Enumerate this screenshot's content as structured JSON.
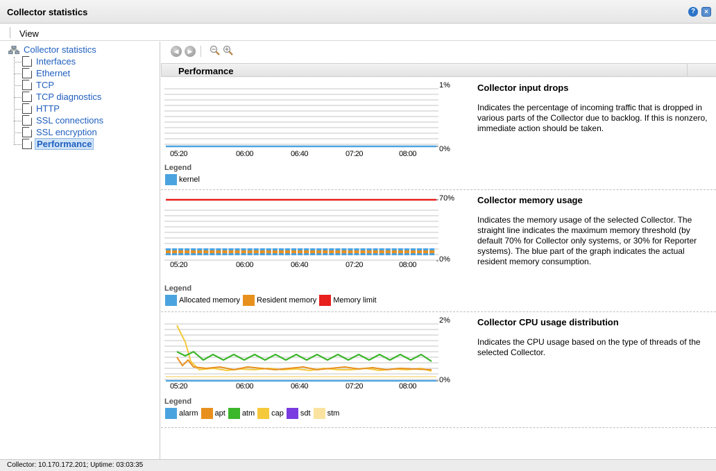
{
  "window": {
    "title": "Collector statistics",
    "help_glyph": "?",
    "close_glyph": "×"
  },
  "menu": {
    "view_label": "View"
  },
  "tree": {
    "root_label": "Collector statistics",
    "items": [
      {
        "label": "Interfaces",
        "selected": false
      },
      {
        "label": "Ethernet",
        "selected": false
      },
      {
        "label": "TCP",
        "selected": false
      },
      {
        "label": "TCP diagnostics",
        "selected": false
      },
      {
        "label": "HTTP",
        "selected": false
      },
      {
        "label": "SSL connections",
        "selected": false
      },
      {
        "label": "SSL encryption",
        "selected": false
      },
      {
        "label": "Performance",
        "selected": true
      }
    ]
  },
  "toolbar": {
    "back_icon": "back-arrow-icon",
    "forward_icon": "forward-arrow-icon",
    "zoom_out_icon": "zoom-out-icon",
    "zoom_in_icon": "zoom-in-icon"
  },
  "section": {
    "title": "Performance"
  },
  "panels": [
    {
      "title": "Collector input drops",
      "description": "Indicates the percentage of incoming traffic that is dropped in various parts of the Collector due to backlog. If this is nonzero, immediate action should be taken.",
      "axis_max": "1%",
      "axis_min": "0%",
      "x_ticks": [
        "05:20",
        "06:00",
        "06:40",
        "07:20",
        "08:00"
      ],
      "legend_title": "Legend",
      "legend": [
        {
          "label": "kernel",
          "color": "#4aa3df"
        }
      ]
    },
    {
      "title": "Collector memory usage",
      "description": "Indicates the memory usage of the selected Collector. The straight line indicates the maximum memory threshold (by default 70% for Collector only systems, or 30% for Reporter systems). The blue part of the graph indicates the actual resident memory consumption.",
      "axis_max": "70%",
      "axis_min": "0%",
      "x_ticks": [
        "05:20",
        "06:00",
        "06:40",
        "07:20",
        "08:00"
      ],
      "legend_title": "Legend",
      "legend": [
        {
          "label": "Allocated memory",
          "color": "#4aa3df"
        },
        {
          "label": "Resident memory",
          "color": "#e8901e"
        },
        {
          "label": "Memory limit",
          "color": "#e8201e"
        }
      ]
    },
    {
      "title": "Collector CPU usage distribution",
      "description": "Indicates the CPU usage based on the type of threads of the selected Collector.",
      "axis_max": "2%",
      "axis_min": "0%",
      "x_ticks": [
        "05:20",
        "06:00",
        "06:40",
        "07:20",
        "08:00"
      ],
      "legend_title": "Legend",
      "legend": [
        {
          "label": "alarm",
          "color": "#4aa3df"
        },
        {
          "label": "apt",
          "color": "#e8901e"
        },
        {
          "label": "atm",
          "color": "#3cb62a"
        },
        {
          "label": "cap",
          "color": "#f5c93a"
        },
        {
          "label": "sdt",
          "color": "#7a3be0"
        },
        {
          "label": "stm",
          "color": "#fae3a0"
        }
      ]
    }
  ],
  "chart_data": [
    {
      "type": "line",
      "title": "Collector input drops",
      "x": [
        "05:20",
        "06:00",
        "06:40",
        "07:20",
        "08:00"
      ],
      "ylim": [
        0,
        1
      ],
      "series": [
        {
          "name": "kernel",
          "values": [
            0,
            0,
            0,
            0,
            0
          ]
        }
      ]
    },
    {
      "type": "bar",
      "title": "Collector memory usage",
      "x": [
        "05:20",
        "06:00",
        "06:40",
        "07:20",
        "08:00"
      ],
      "ylim": [
        0,
        70
      ],
      "series": [
        {
          "name": "Allocated memory",
          "values": [
            10,
            10,
            10,
            10,
            10
          ]
        },
        {
          "name": "Resident memory",
          "values": [
            8,
            8,
            8,
            8,
            8
          ]
        },
        {
          "name": "Memory limit",
          "values": [
            70,
            70,
            70,
            70,
            70
          ]
        }
      ]
    },
    {
      "type": "line",
      "title": "Collector CPU usage distribution",
      "x": [
        "05:20",
        "06:00",
        "06:40",
        "07:20",
        "08:00"
      ],
      "ylim": [
        0,
        2
      ],
      "series": [
        {
          "name": "alarm",
          "values": [
            0.05,
            0.05,
            0.05,
            0.05,
            0.05
          ]
        },
        {
          "name": "apt",
          "values": [
            0.65,
            0.4,
            0.45,
            0.43,
            0.48
          ]
        },
        {
          "name": "atm",
          "values": [
            0.8,
            0.8,
            0.75,
            0.78,
            0.6
          ]
        },
        {
          "name": "cap",
          "values": [
            0.45,
            0.45,
            0.43,
            0.45,
            0.42
          ]
        },
        {
          "name": "sdt",
          "values": [
            0,
            0,
            0,
            0,
            0
          ]
        },
        {
          "name": "stm",
          "values": [
            0.3,
            0.3,
            0.3,
            0.3,
            0.3
          ]
        }
      ]
    }
  ],
  "status": {
    "text": "Collector: 10.170.172.201; Uptime: 03:03:35"
  }
}
